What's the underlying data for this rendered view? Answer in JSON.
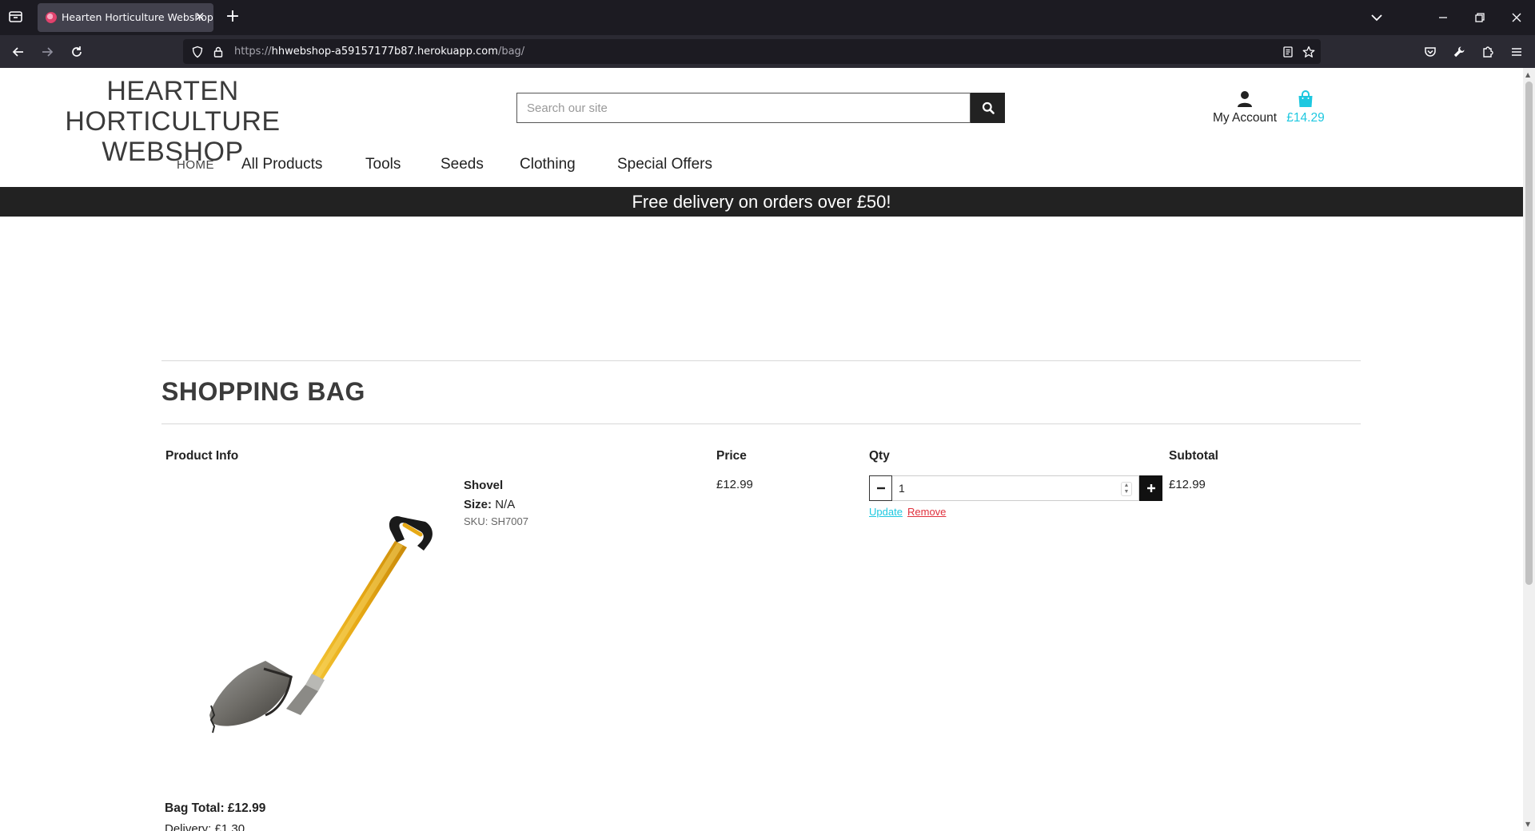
{
  "browser": {
    "tab_title": "Hearten Horticulture Webshop",
    "url_prefix": "https://",
    "url_host": "hhwebshop-a59157177b87.herokuapp.com",
    "url_path": "/bag/"
  },
  "header": {
    "logo_line1": "HEARTEN HORTICULTURE",
    "logo_line2": "WEBSHOP",
    "search_placeholder": "Search our site",
    "account_label": "My Account",
    "bag_total": "£14.29"
  },
  "nav": {
    "home": "HOME",
    "items": [
      "All Products",
      "Tools",
      "Seeds",
      "Clothing",
      "Special Offers"
    ]
  },
  "banner": "Free delivery on orders over £50!",
  "bag": {
    "title": "SHOPPING BAG",
    "columns": {
      "product_info": "Product Info",
      "price": "Price",
      "qty": "Qty",
      "subtotal": "Subtotal"
    },
    "item": {
      "name": "Shovel",
      "size_label": "Size:",
      "size_value": "N/A",
      "sku": "SKU: SH7007",
      "price": "£12.99",
      "qty": "1",
      "subtotal": "£12.99",
      "update": "Update",
      "remove": "Remove"
    },
    "total_line": "Bag Total: £12.99",
    "delivery_line": "Delivery: £1.30"
  },
  "colors": {
    "accent": "#1ec8e0",
    "danger": "#e0303c",
    "dark": "#222222"
  }
}
